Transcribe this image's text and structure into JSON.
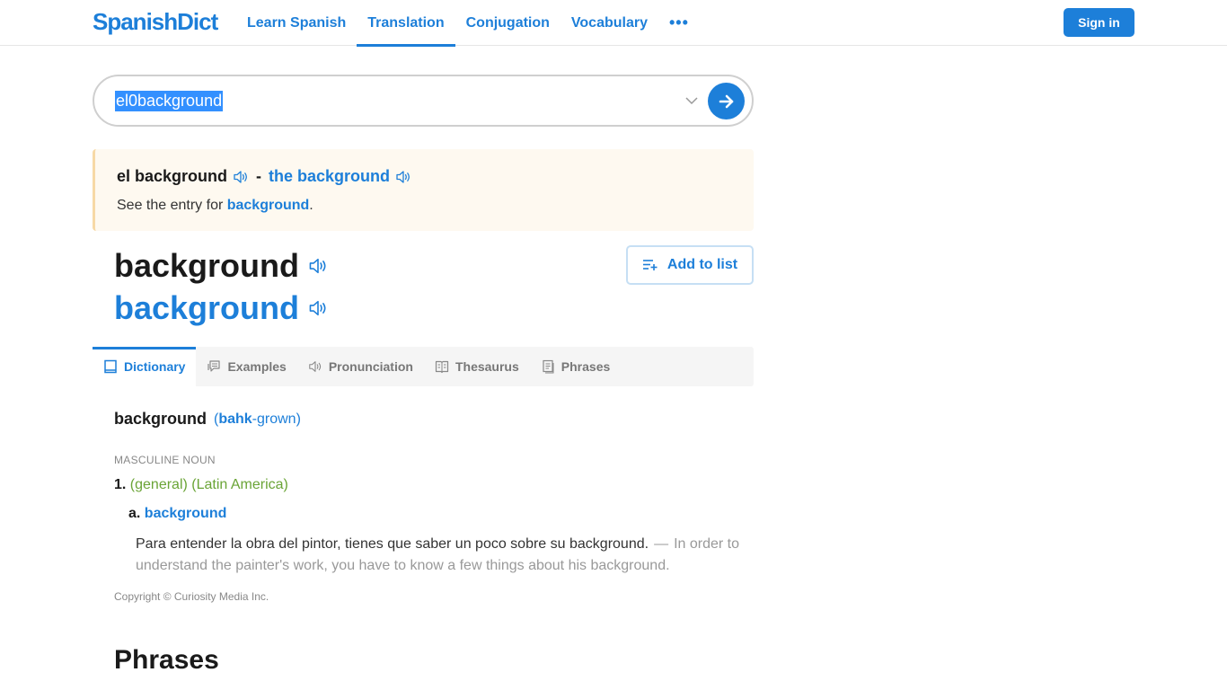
{
  "header": {
    "logo": "SpanishDict",
    "nav": [
      {
        "label": "Learn Spanish",
        "active": false
      },
      {
        "label": "Translation",
        "active": true
      },
      {
        "label": "Conjugation",
        "active": false
      },
      {
        "label": "Vocabulary",
        "active": false
      }
    ],
    "more_label": "•••",
    "signin_label": "Sign in"
  },
  "search": {
    "value": "el0background",
    "chevron_icon": "chevron-down-icon",
    "go_icon": "arrow-right-icon"
  },
  "quick_translation": {
    "spanish": "el background",
    "dash": "-",
    "english": "the background",
    "see_prefix": "See the entry for ",
    "see_link": "background",
    "see_suffix": "."
  },
  "headword": {
    "spanish": "background",
    "english": "background",
    "add_to_list_label": "Add to list"
  },
  "tabs": [
    {
      "label": "Dictionary",
      "icon": "book-icon",
      "active": true
    },
    {
      "label": "Examples",
      "icon": "speech-bubble-icon",
      "active": false
    },
    {
      "label": "Pronunciation",
      "icon": "speaker-icon",
      "active": false
    },
    {
      "label": "Thesaurus",
      "icon": "open-book-icon",
      "active": false
    },
    {
      "label": "Phrases",
      "icon": "document-icon",
      "active": false
    }
  ],
  "entry": {
    "word": "background",
    "pron_open": "(",
    "pron_stressed": "bahk",
    "pron_rest": "-grown)",
    "part_of_speech": "MASCULINE NOUN",
    "senses": [
      {
        "number": "1.",
        "context": "(general) (Latin America)",
        "translations": [
          {
            "letter": "a.",
            "translation": "background",
            "example_es": "Para entender la obra del pintor, tienes que saber un poco sobre su background.",
            "example_dash": "—",
            "example_en": "In order to understand the painter's work, you have to know a few things about his background."
          }
        ]
      }
    ],
    "copyright": "Copyright © Curiosity Media Inc."
  },
  "phrases_heading": "Phrases"
}
